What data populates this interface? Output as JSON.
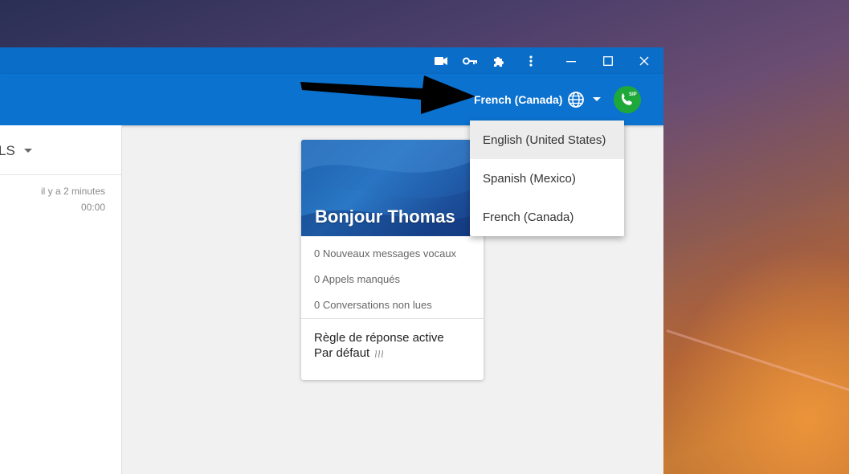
{
  "titlebar": {
    "icons": [
      "video-camera-icon",
      "key-icon",
      "puzzle-extension-icon",
      "more-vert-icon",
      "minimize-icon",
      "maximize-icon",
      "close-icon"
    ]
  },
  "header": {
    "language_selected": "French (Canada)",
    "sip_badge": "SIP"
  },
  "language_menu": {
    "options": [
      "English (United States)",
      "Spanish (Mexico)",
      "French (Canada)"
    ],
    "highlighted": "English (United States)"
  },
  "left_panel": {
    "filter_label": "LS",
    "item": {
      "time_ago": "il y a 2 minutes",
      "duration": "00:00"
    }
  },
  "welcome_card": {
    "greeting": "Bonjour Thomas",
    "stats": [
      "0 Nouveaux messages vocaux",
      "0 Appels manqués",
      "0 Conversations non lues"
    ],
    "rule_title": "Règle de réponse active",
    "rule_value": "Par défaut"
  },
  "colors": {
    "titlebar": "#0a6ec9",
    "appbar": "#0b72d0",
    "sip_button": "#1fa83a",
    "menu_highlight": "#ececec"
  }
}
